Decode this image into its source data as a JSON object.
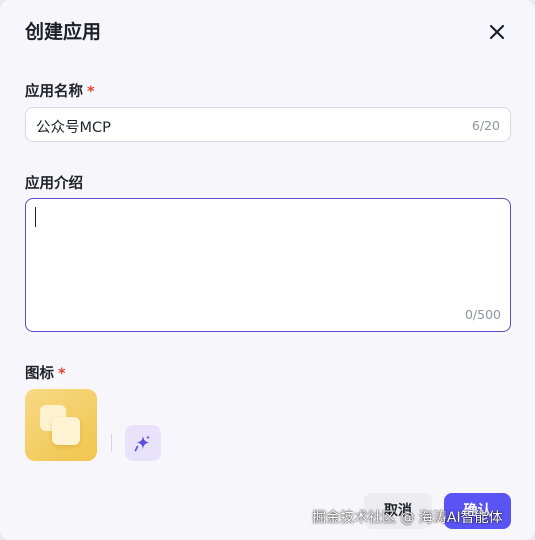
{
  "dialog": {
    "title": "创建应用",
    "close_icon": "close-icon"
  },
  "name_field": {
    "label": "应用名称",
    "required_mark": "*",
    "value": "公众号MCP",
    "counter": "6/20"
  },
  "intro_field": {
    "label": "应用介绍",
    "value": "",
    "counter": "0/500"
  },
  "icon_field": {
    "label": "图标",
    "required_mark": "*",
    "icon_colors": {
      "gradient_start": "#f7d985",
      "gradient_end": "#f1c54d"
    },
    "ai_generate_icon": "sparkle-icon"
  },
  "footer": {
    "cancel_label": "取消",
    "ok_label": "确认"
  },
  "watermark": "掘金技术社区 @ 海涛AI智能体",
  "colors": {
    "accent": "#5a54f5",
    "focus_border": "#5a4fcf",
    "required": "#e3432b"
  }
}
